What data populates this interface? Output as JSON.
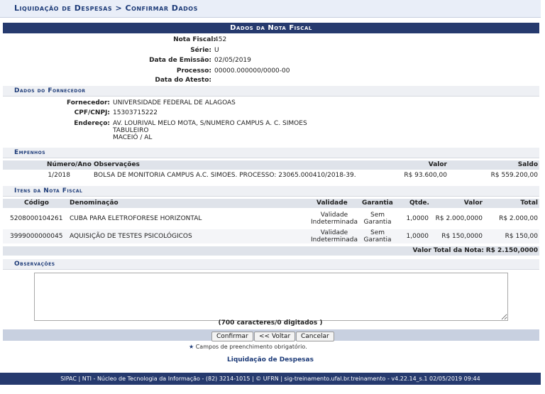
{
  "breadcrumb": "Liquidação de Despesas > Confirmar Dados",
  "caption": "Dados da Nota Fiscal",
  "nota": {
    "fields": [
      {
        "label": "Nota Fiscal:",
        "value": "452"
      },
      {
        "label": "Série:",
        "value": "U"
      },
      {
        "label": "Data de Emissão:",
        "value": "02/05/2019"
      },
      {
        "label": "Processo:",
        "value": "00000.000000/0000-00"
      },
      {
        "label": "Data do Atesto:",
        "value": ""
      }
    ]
  },
  "fornecedor": {
    "title": "Dados do Fornecedor",
    "fields": [
      {
        "label": "Fornecedor:",
        "value": "UNIVERSIDADE FEDERAL DE ALAGOAS"
      },
      {
        "label": "CPF/CNPJ:",
        "value": "15303715222"
      },
      {
        "label": "Endereço:",
        "value": "AV. LOURIVAL MELO MOTA, S/NUMERO CAMPUS A. C. SIMOES"
      }
    ],
    "address_line2": "TABULEIRO",
    "address_line3": "MACEIÓ / AL"
  },
  "empenhos": {
    "title": "Empenhos",
    "headers": [
      "Número/Ano",
      "Observações",
      "Valor",
      "Saldo"
    ],
    "rows": [
      [
        "1/2018",
        "BOLSA DE MONITORIA CAMPUS A.C. SIMOES. PROCESSO: 23065.000410/2018-39.",
        "R$ 93.600,00",
        "R$ 559.200,00"
      ]
    ]
  },
  "itens": {
    "title": "Itens da Nota Fiscal",
    "headers": [
      "Código",
      "Denominação",
      "Validade",
      "Garantia",
      "Qtde.",
      "Valor",
      "Total"
    ],
    "rows": [
      [
        "5208000104261",
        "CUBA PARA ELETROFORESE HORIZONTAL",
        "Validade",
        "Indeterminada",
        "Sem",
        "Garantia",
        "1,0000",
        "R$ 2.000,0000",
        "R$ 2.000,00"
      ],
      [
        "3999000000045",
        "AQUISIÇÃO DE TESTES PSICOLÓGICOS",
        "Validade",
        "Indeterminada",
        "Sem",
        "Garantia",
        "1,0000",
        "R$ 150,0000",
        "R$ 150,00"
      ]
    ],
    "total_label": "Valor Total da Nota:",
    "total_value": "R$ 2.150,0000"
  },
  "observacoes": {
    "title": "Observações",
    "counter": "(700 caracteres/0 digitados )"
  },
  "buttons": {
    "confirmar": "Confirmar",
    "voltar": "<< Voltar",
    "cancelar": "Cancelar"
  },
  "required_note": "Campos de preenchimento obrigatório.",
  "link": "Liquidação de Despesas",
  "footer": "SIPAC | NTI - Núcleo de Tecnologia da Informação - (82) 3214-1015 | © UFRN | sig-treinamento.ufal.br.treinamento - v4.22.14_s.1 02/05/2019 09:44",
  "colors": {
    "accent": "#263a6e",
    "header_bg": "#e9eef8"
  }
}
